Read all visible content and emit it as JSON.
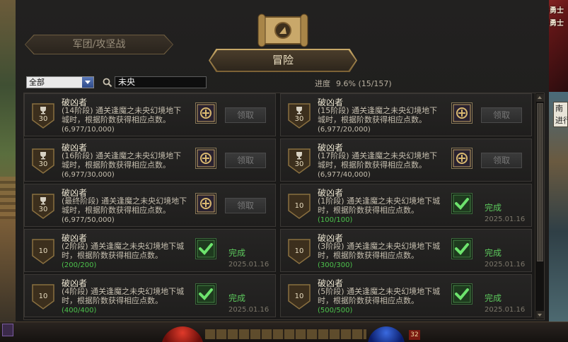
{
  "tabs": [
    {
      "label": "军团/攻坚战",
      "active": false
    },
    {
      "label": "冒险",
      "active": true
    }
  ],
  "filter": {
    "selected": "全部",
    "search_value": "未央"
  },
  "progress": {
    "label": "进度",
    "value": "9.6% (15/157)"
  },
  "achievements": [
    {
      "title": "破凶者",
      "desc": "(14阶段) 通关逢魔之未央幻境地下城时，根据阶数获得相应点数。",
      "progress": "(6,977/10,000)",
      "points": "30",
      "state": "claim",
      "action": "领取"
    },
    {
      "title": "破凶者",
      "desc": "(15阶段) 通关逢魔之未央幻境地下城时，根据阶数获得相应点数。",
      "progress": "(6,977/20,000)",
      "points": "30",
      "state": "claim",
      "action": "领取"
    },
    {
      "title": "破凶者",
      "desc": "(16阶段) 通关逢魔之未央幻境地下城时，根据阶数获得相应点数。",
      "progress": "(6,977/30,000)",
      "points": "30",
      "state": "claim",
      "action": "领取"
    },
    {
      "title": "破凶者",
      "desc": "(17阶段) 通关逢魔之未央幻境地下城时，根据阶数获得相应点数。",
      "progress": "(6,977/40,000)",
      "points": "30",
      "state": "claim",
      "action": "领取"
    },
    {
      "title": "破凶者",
      "desc": "(最终阶段) 通关逢魔之未央幻境地下城时，根据阶数获得相应点数。",
      "progress": "(6,977/50,000)",
      "points": "30",
      "state": "claim",
      "action": "领取"
    },
    {
      "title": "破凶者",
      "desc": "(1阶段) 通关逢魔之未央幻境地下城时，根据阶数获得相应点数。",
      "progress": "(100/100)",
      "points": "10",
      "state": "done",
      "status": "完成",
      "date": "2025.01.16"
    },
    {
      "title": "破凶者",
      "desc": "(2阶段) 通关逢魔之未央幻境地下城时，根据阶数获得相应点数。",
      "progress": "(200/200)",
      "points": "10",
      "state": "done",
      "status": "完成",
      "date": "2025.01.16"
    },
    {
      "title": "破凶者",
      "desc": "(3阶段) 通关逢魔之未央幻境地下城时，根据阶数获得相应点数。",
      "progress": "(300/300)",
      "points": "10",
      "state": "done",
      "status": "完成",
      "date": "2025.01.16"
    },
    {
      "title": "破凶者",
      "desc": "(4阶段) 通关逢魔之未央幻境地下城时，根据阶数获得相应点数。",
      "progress": "(400/400)",
      "points": "10",
      "state": "done",
      "status": "完成",
      "date": "2025.01.16"
    },
    {
      "title": "破凶者",
      "desc": "(5阶段) 通关逢魔之未央幻境地下城时，根据阶数获得相应点数。",
      "progress": "(500/500)",
      "points": "10",
      "state": "done",
      "status": "完成",
      "date": "2025.01.16"
    }
  ],
  "side_text": "南\n进行",
  "banner_logo": "地下城与勇士",
  "hud_level": "32",
  "colors": {
    "complete": "#5cc85c",
    "gold": "#c8a968"
  }
}
